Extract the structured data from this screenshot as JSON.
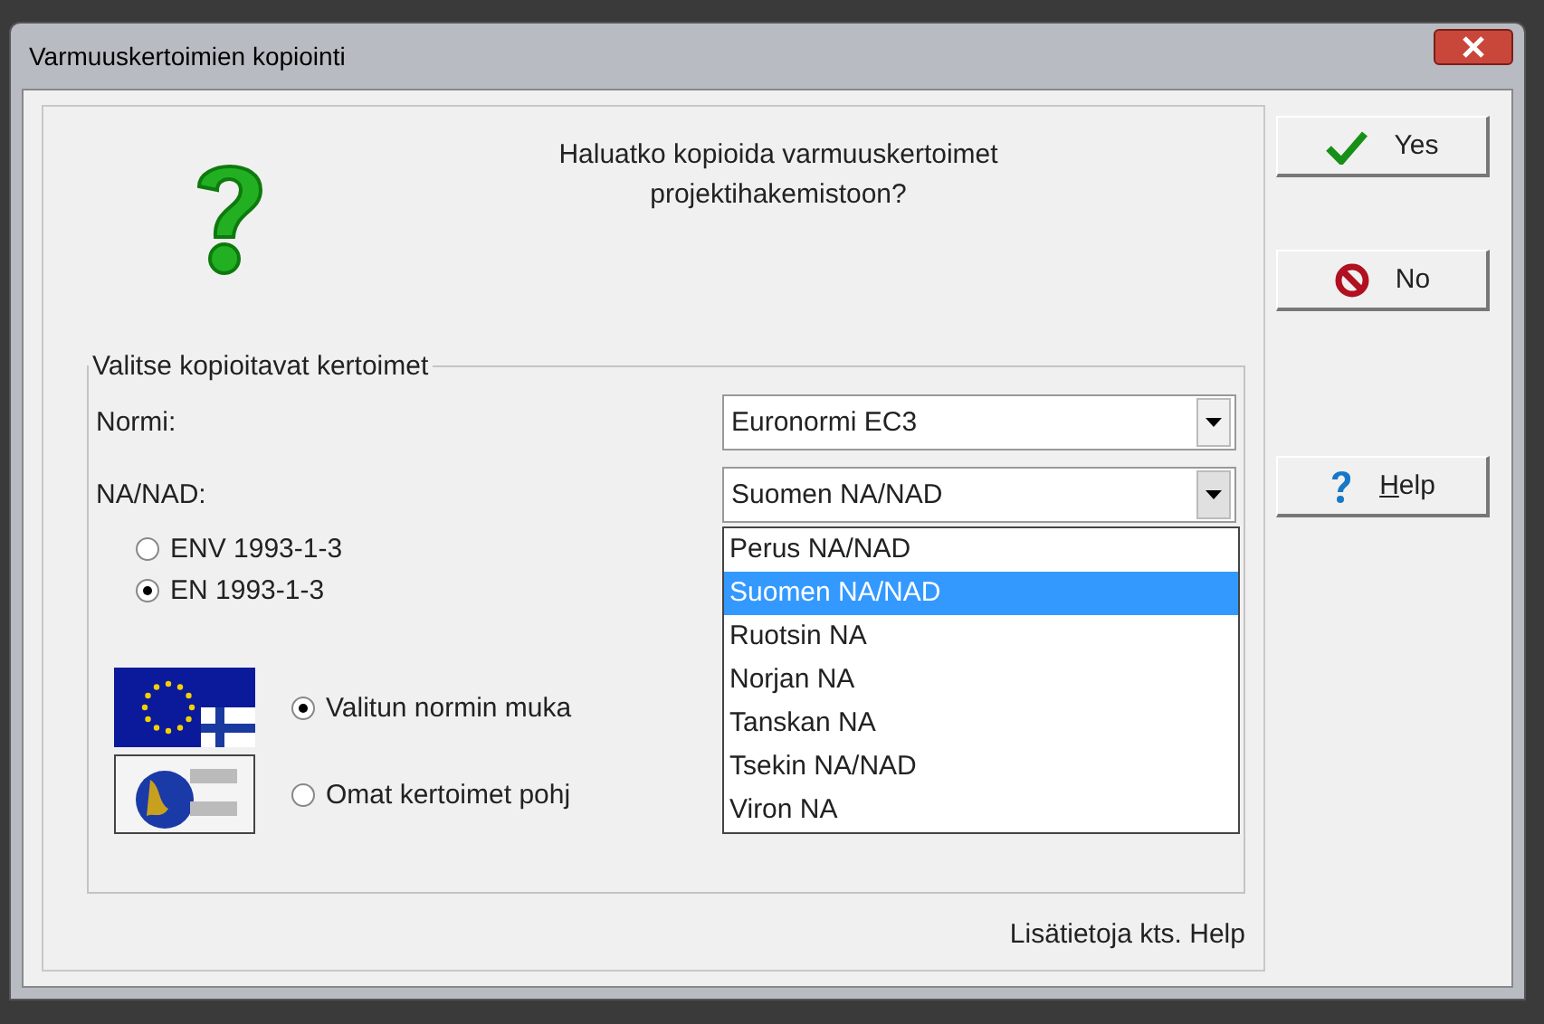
{
  "window": {
    "title": "Varmuuskertoimien kopiointi"
  },
  "question": [
    "Haluatko kopioida varmuuskertoimet",
    "projektihakemistoon?"
  ],
  "group": {
    "title": "Valitse kopioitavat kertoimet",
    "fields": [
      {
        "label": "Normi:",
        "value": "Euronormi EC3",
        "expanded": false
      },
      {
        "label": "NA/NAD:",
        "value": "Suomen NA/NAD",
        "expanded": true
      }
    ],
    "standards": [
      {
        "label": "ENV 1993-1-3",
        "selected": false
      },
      {
        "label": "EN 1993-1-3",
        "selected": true
      }
    ],
    "sources": [
      {
        "kind": "flag",
        "label": "Valitun normin muka",
        "selected": true
      },
      {
        "kind": "custom",
        "label": "Omat kertoimet pohj",
        "selected": false
      }
    ]
  },
  "dropdown": [
    {
      "label": "Perus NA/NAD",
      "selected": false
    },
    {
      "label": "Suomen NA/NAD",
      "selected": true
    },
    {
      "label": "Ruotsin NA",
      "selected": false
    },
    {
      "label": "Norjan NA",
      "selected": false
    },
    {
      "label": "Tanskan NA",
      "selected": false
    },
    {
      "label": "Tsekin NA/NAD",
      "selected": false
    },
    {
      "label": "Viron NA",
      "selected": false
    }
  ],
  "footer": "Lisätietoja kts. Help",
  "buttons": [
    {
      "kind": "yes",
      "label": "Yes"
    },
    {
      "kind": "no",
      "label": "No"
    },
    {
      "kind": "help",
      "label": "Help",
      "mnemonic_underlined": true
    }
  ]
}
